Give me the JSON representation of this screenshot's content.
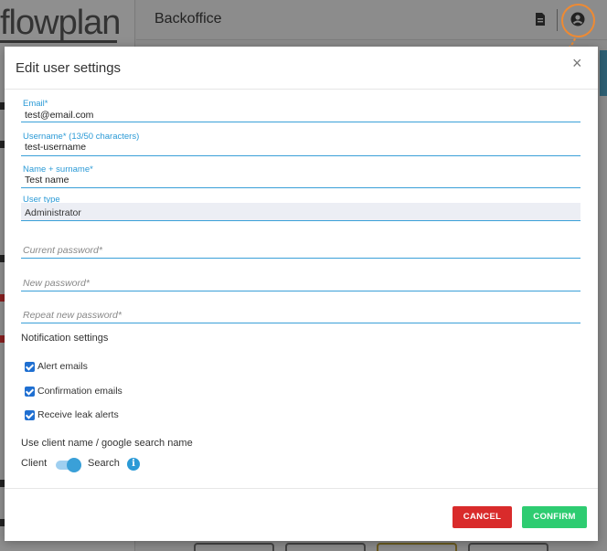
{
  "app": {
    "logo_text": "flowplan",
    "title": "Backoffice"
  },
  "modal": {
    "title": "Edit user settings",
    "close_glyph": "×",
    "fields": {
      "email": {
        "label": "Email*",
        "value": "test@email.com"
      },
      "username": {
        "label": "Username* (13/50 characters)",
        "value": "test-username"
      },
      "name": {
        "label": "Name + surname*",
        "value": "Test name"
      },
      "user_type": {
        "label": "User type",
        "value": "Administrator"
      },
      "current_password": {
        "placeholder": "Current password*"
      },
      "new_password": {
        "placeholder": "New password*"
      },
      "repeat_password": {
        "placeholder": "Repeat new password*"
      }
    },
    "notifications": {
      "title": "Notification settings",
      "items": [
        {
          "label": "Alert emails",
          "checked": true
        },
        {
          "label": "Confirmation emails",
          "checked": true
        },
        {
          "label": "Receive leak alerts",
          "checked": true
        }
      ]
    },
    "name_source": {
      "title": "Use client name / google search name",
      "left_label": "Client",
      "right_label": "Search",
      "selected": "Search",
      "info_glyph": "i"
    },
    "buttons": {
      "cancel": "CANCEL",
      "confirm": "CONFIRM"
    }
  },
  "colors": {
    "accent": "#2b9ad6",
    "cancel": "#d92b2b",
    "confirm": "#2ecc71",
    "highlight": "#ee8a33"
  },
  "icons": {
    "topbar_left": "document-icon",
    "topbar_right": "user-account-icon"
  }
}
